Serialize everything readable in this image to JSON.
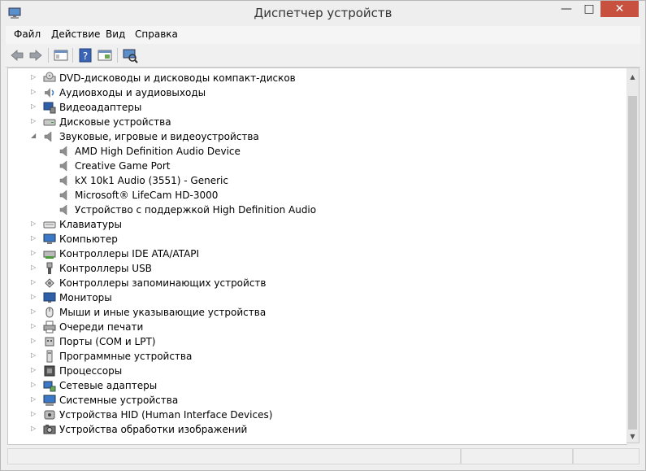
{
  "window": {
    "title": "Диспетчер устройств"
  },
  "menu": [
    "Файл",
    "Действие",
    "Вид",
    "Справка"
  ],
  "tree": [
    {
      "label": "DVD-дисководы и дисководы компакт-дисков",
      "level": 0,
      "state": "collapsed",
      "icon": "dvd-drive-icon"
    },
    {
      "label": "Аудиовходы и аудиовыходы",
      "level": 0,
      "state": "collapsed",
      "icon": "audio-io-icon"
    },
    {
      "label": "Видеоадаптеры",
      "level": 0,
      "state": "collapsed",
      "icon": "display-adapter-icon"
    },
    {
      "label": "Дисковые устройства",
      "level": 0,
      "state": "collapsed",
      "icon": "disk-drive-icon"
    },
    {
      "label": "Звуковые, игровые и видеоустройства",
      "level": 0,
      "state": "expanded",
      "icon": "speaker-icon"
    },
    {
      "label": "AMD High Definition Audio Device",
      "level": 1,
      "icon": "speaker-icon"
    },
    {
      "label": "Creative Game Port",
      "level": 1,
      "icon": "speaker-icon"
    },
    {
      "label": "kX 10k1 Audio (3551) - Generic",
      "level": 1,
      "icon": "speaker-icon"
    },
    {
      "label": "Microsoft® LifeCam HD-3000",
      "level": 1,
      "icon": "speaker-icon"
    },
    {
      "label": "Устройство с поддержкой High Definition Audio",
      "level": 1,
      "icon": "speaker-icon"
    },
    {
      "label": "Клавиатуры",
      "level": 0,
      "state": "collapsed",
      "icon": "keyboard-icon"
    },
    {
      "label": "Компьютер",
      "level": 0,
      "state": "collapsed",
      "icon": "computer-icon"
    },
    {
      "label": "Контроллеры IDE ATA/ATAPI",
      "level": 0,
      "state": "collapsed",
      "icon": "ide-controller-icon"
    },
    {
      "label": "Контроллеры USB",
      "level": 0,
      "state": "collapsed",
      "icon": "usb-icon"
    },
    {
      "label": "Контроллеры запоминающих устройств",
      "level": 0,
      "state": "collapsed",
      "icon": "storage-controller-icon"
    },
    {
      "label": "Мониторы",
      "level": 0,
      "state": "collapsed",
      "icon": "monitor-icon"
    },
    {
      "label": "Мыши и иные указывающие устройства",
      "level": 0,
      "state": "collapsed",
      "icon": "mouse-icon"
    },
    {
      "label": "Очереди печати",
      "level": 0,
      "state": "collapsed",
      "icon": "printer-icon"
    },
    {
      "label": "Порты (COM и LPT)",
      "level": 0,
      "state": "collapsed",
      "icon": "port-icon"
    },
    {
      "label": "Программные устройства",
      "level": 0,
      "state": "collapsed",
      "icon": "software-device-icon"
    },
    {
      "label": "Процессоры",
      "level": 0,
      "state": "collapsed",
      "icon": "processor-icon"
    },
    {
      "label": "Сетевые адаптеры",
      "level": 0,
      "state": "collapsed",
      "icon": "network-adapter-icon"
    },
    {
      "label": "Системные устройства",
      "level": 0,
      "state": "collapsed",
      "icon": "system-device-icon"
    },
    {
      "label": "Устройства HID (Human Interface Devices)",
      "level": 0,
      "state": "collapsed",
      "icon": "hid-icon"
    },
    {
      "label": "Устройства обработки изображений",
      "level": 0,
      "state": "collapsed",
      "icon": "imaging-device-icon"
    }
  ],
  "glyphs": {
    "collapsed": "▷",
    "expanded": "◢",
    "minimize": "—",
    "maximize": "□",
    "close": "✕",
    "scroll_up": "▲",
    "scroll_down": "▼"
  }
}
